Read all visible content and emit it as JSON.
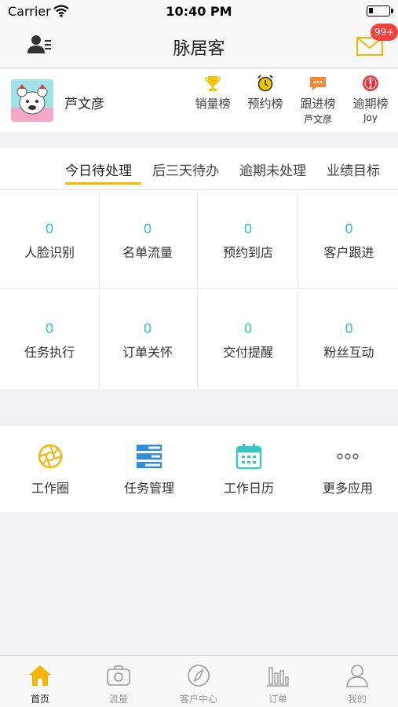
{
  "status_bar": {
    "carrier": "Carrier",
    "time": "10:40 PM"
  },
  "nav": {
    "title": "脉居客",
    "message_badge": "99+"
  },
  "user": {
    "name": "芦文彦"
  },
  "rankings": [
    {
      "label": "销量榜",
      "sub": "",
      "icon": "trophy-icon"
    },
    {
      "label": "预约榜",
      "sub": "",
      "icon": "alarm-clock-icon"
    },
    {
      "label": "跟进榜",
      "sub": "芦文彦",
      "icon": "chat-bubble-icon"
    },
    {
      "label": "逾期榜",
      "sub": "Joy",
      "icon": "alert-icon"
    }
  ],
  "tabs": [
    {
      "label": "今日待处理",
      "active": true
    },
    {
      "label": "后三天待办",
      "active": false
    },
    {
      "label": "逾期未处理",
      "active": false
    },
    {
      "label": "业绩目标",
      "active": false
    }
  ],
  "tasks": [
    {
      "value": "0",
      "label": "人脸识别"
    },
    {
      "value": "0",
      "label": "名单流量"
    },
    {
      "value": "0",
      "label": "预约到店"
    },
    {
      "value": "0",
      "label": "客户跟进"
    },
    {
      "value": "0",
      "label": "任务执行"
    },
    {
      "value": "0",
      "label": "订单关怀"
    },
    {
      "value": "0",
      "label": "交付提醒"
    },
    {
      "value": "0",
      "label": "粉丝互动"
    }
  ],
  "apps": [
    {
      "label": "工作圈",
      "icon": "aperture-icon"
    },
    {
      "label": "任务管理",
      "icon": "task-list-icon"
    },
    {
      "label": "工作日历",
      "icon": "calendar-icon"
    },
    {
      "label": "更多应用",
      "icon": "more-dots-icon"
    }
  ],
  "tabbar": [
    {
      "label": "首页",
      "icon": "home-icon",
      "active": true
    },
    {
      "label": "流量",
      "icon": "camera-icon",
      "active": false
    },
    {
      "label": "客户中心",
      "icon": "compass-icon",
      "active": false
    },
    {
      "label": "订单",
      "icon": "bar-chart-icon",
      "active": false
    },
    {
      "label": "我的",
      "icon": "person-icon",
      "active": false
    }
  ],
  "colors": {
    "accent": "#f5b500",
    "teal": "#36c8c0",
    "badge": "#f0413d",
    "blue": "#2f8fd8"
  }
}
